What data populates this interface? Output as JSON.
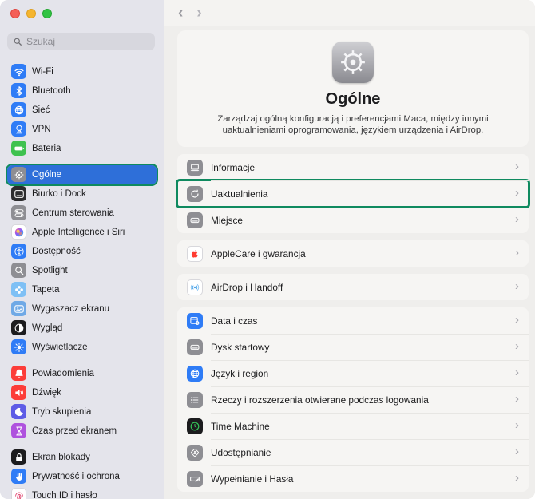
{
  "annotation": {
    "color": "#0f8a5f",
    "highlighted_sidebar_item": "Ogólne",
    "highlighted_row": "Uaktualnienia"
  },
  "window_controls": {
    "close": "close-button",
    "minimize": "minimize-button",
    "zoom": "zoom-button"
  },
  "toolbar": {
    "back_icon": "chevron-left-icon",
    "forward_icon": "chevron-right-icon"
  },
  "sidebar": {
    "search": {
      "placeholder": "Szukaj",
      "icon": "search-icon"
    },
    "selected_color": "#2e6fd9",
    "groups": [
      {
        "items": [
          {
            "label": "Wi-Fi",
            "icon": "wifi-icon",
            "icon_bg": "#2f7cf6"
          },
          {
            "label": "Bluetooth",
            "icon": "bluetooth-icon",
            "icon_bg": "#2f7cf6"
          },
          {
            "label": "Sieć",
            "icon": "globe-icon",
            "icon_bg": "#2f7cf6"
          },
          {
            "label": "VPN",
            "icon": "vpn-icon",
            "icon_bg": "#2f7cf6"
          },
          {
            "label": "Bateria",
            "icon": "battery-icon",
            "icon_bg": "#3fc24f"
          }
        ]
      },
      {
        "items": [
          {
            "label": "Ogólne",
            "icon": "gear-icon",
            "icon_bg": "#8e8e93",
            "selected": true
          },
          {
            "label": "Biurko i Dock",
            "icon": "dock-icon",
            "icon_bg": "#2c2c2e"
          },
          {
            "label": "Centrum sterowania",
            "icon": "control-center-icon",
            "icon_bg": "#8e8e93"
          },
          {
            "label": "Apple Intelligence i Siri",
            "icon": "siri-icon",
            "icon_bg": "#ffffff"
          },
          {
            "label": "Dostępność",
            "icon": "accessibility-icon",
            "icon_bg": "#2f7cf6"
          },
          {
            "label": "Spotlight",
            "icon": "spotlight-icon",
            "icon_bg": "#8e8e93"
          },
          {
            "label": "Tapeta",
            "icon": "wallpaper-icon",
            "icon_bg": "#7ec0f5"
          },
          {
            "label": "Wygaszacz ekranu",
            "icon": "screensaver-icon",
            "icon_bg": "#6fa9e6"
          },
          {
            "label": "Wygląd",
            "icon": "appearance-icon",
            "icon_bg": "#1c1c1e"
          },
          {
            "label": "Wyświetlacze",
            "icon": "display-brightness-icon",
            "icon_bg": "#2f7cf6"
          }
        ]
      },
      {
        "items": [
          {
            "label": "Powiadomienia",
            "icon": "bell-icon",
            "icon_bg": "#fc3d39"
          },
          {
            "label": "Dźwięk",
            "icon": "speaker-icon",
            "icon_bg": "#fc3d39"
          },
          {
            "label": "Tryb skupienia",
            "icon": "moon-icon",
            "icon_bg": "#5e5ce6"
          },
          {
            "label": "Czas przed ekranem",
            "icon": "hourglass-icon",
            "icon_bg": "#af52de"
          }
        ]
      },
      {
        "items": [
          {
            "label": "Ekran blokady",
            "icon": "lock-icon",
            "icon_bg": "#1c1c1e"
          },
          {
            "label": "Prywatność i ochrona",
            "icon": "hand-icon",
            "icon_bg": "#2f7cf6"
          },
          {
            "label": "Touch ID i hasło",
            "icon": "fingerprint-icon",
            "icon_bg": "#ffffff"
          }
        ]
      }
    ]
  },
  "hero": {
    "icon": "gear-icon",
    "title": "Ogólne",
    "description": "Zarządzaj ogólną konfiguracją i preferencjami Maca, między innymi uaktualnieniami oprogramowania, językiem urządzenia i AirDrop."
  },
  "main": {
    "cards": [
      {
        "rows": [
          {
            "label": "Informacje",
            "icon": "laptop-icon",
            "icon_bg": "#8e8e93"
          },
          {
            "label": "Uaktualnienia",
            "icon": "software-update-icon",
            "icon_bg": "#8e8e93",
            "annotated": true
          },
          {
            "label": "Miejsce",
            "icon": "storage-icon",
            "icon_bg": "#8e8e93"
          }
        ]
      },
      {
        "rows": [
          {
            "label": "AppleCare i gwarancja",
            "icon": "apple-logo-icon",
            "icon_bg": "#ffffff"
          }
        ]
      },
      {
        "rows": [
          {
            "label": "AirDrop i Handoff",
            "icon": "airdrop-icon",
            "icon_bg": "#ffffff"
          }
        ]
      },
      {
        "rows": [
          {
            "label": "Data i czas",
            "icon": "calendar-clock-icon",
            "icon_bg": "#2f7cf6"
          },
          {
            "label": "Dysk startowy",
            "icon": "startup-disk-icon",
            "icon_bg": "#8e8e93"
          },
          {
            "label": "Język i region",
            "icon": "globe-icon",
            "icon_bg": "#2f7cf6"
          },
          {
            "label": "Rzeczy i rozszerzenia otwierane podczas logowania",
            "icon": "list-icon",
            "icon_bg": "#8e8e93"
          },
          {
            "label": "Time Machine",
            "icon": "time-machine-icon",
            "icon_bg": "#1c1c1e"
          },
          {
            "label": "Udostępnianie",
            "icon": "sharing-icon",
            "icon_bg": "#8e8e93"
          },
          {
            "label": "Wypełnianie i Hasła",
            "icon": "autofill-icon",
            "icon_bg": "#8e8e93"
          }
        ]
      }
    ]
  }
}
